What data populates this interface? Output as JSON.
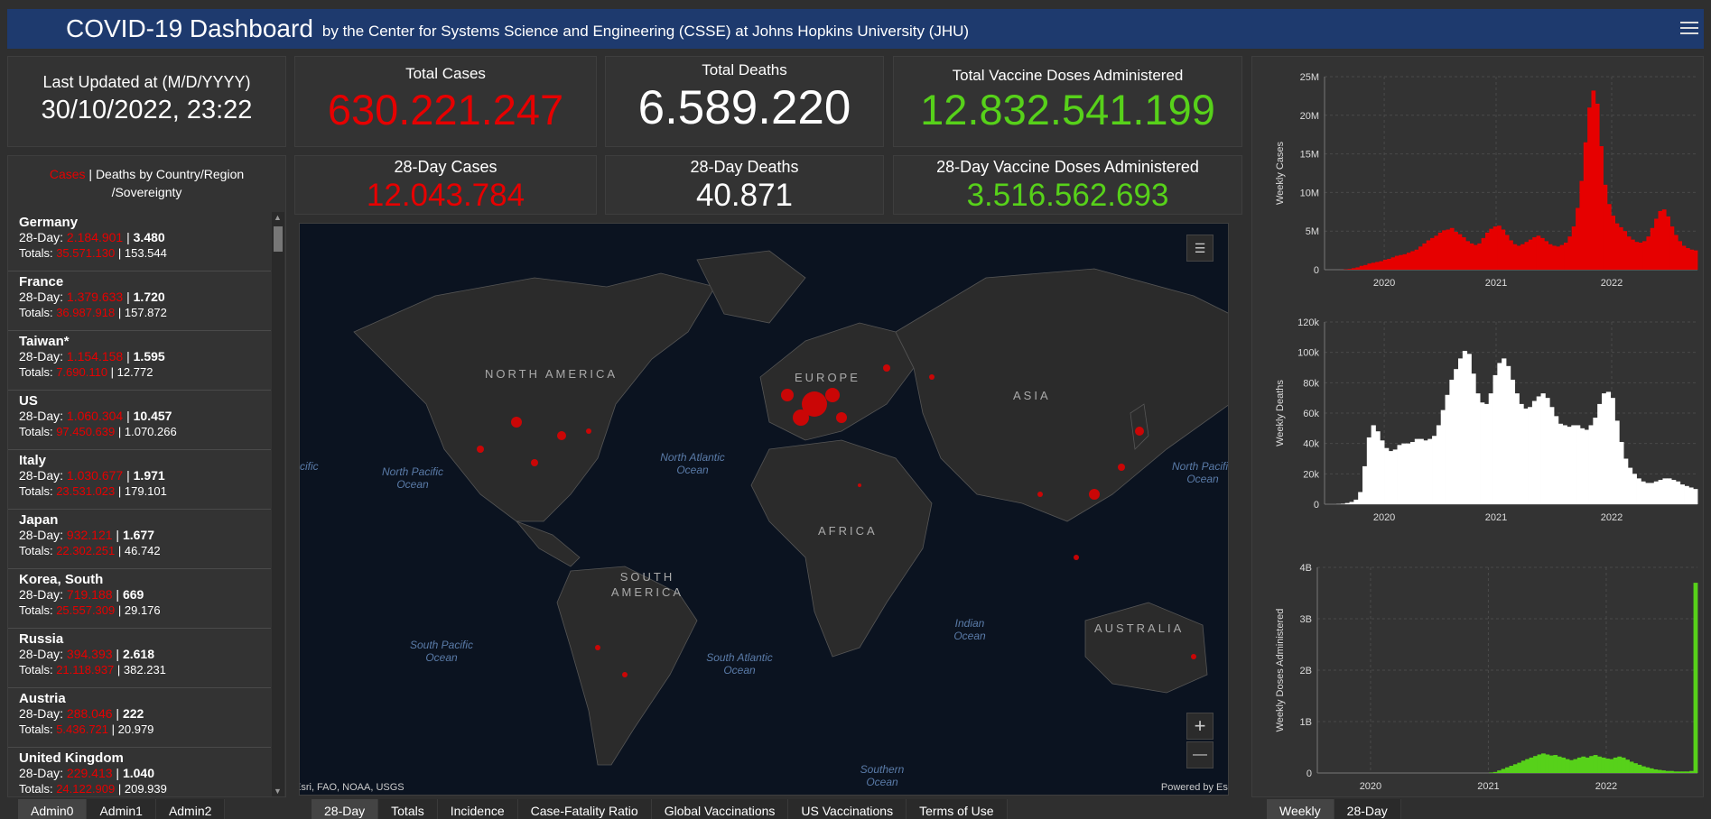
{
  "header": {
    "title": "COVID-19 Dashboard",
    "subtitle": "by the Center for Systems Science and Engineering (CSSE) at Johns Hopkins University (JHU)"
  },
  "last_updated": {
    "label": "Last Updated at (M/D/YYYY)",
    "value": "30/10/2022, 23:22"
  },
  "totals": {
    "cases_label": "Total Cases",
    "cases": "630.221.247",
    "deaths_label": "Total Deaths",
    "deaths": "6.589.220",
    "vaccine_label": "Total Vaccine Doses Administered",
    "vaccine": "12.832.541.199",
    "cases28_label": "28-Day Cases",
    "cases28": "12.043.784",
    "deaths28_label": "28-Day Deaths",
    "deaths28": "40.871",
    "vaccine28_label": "28-Day Vaccine Doses Administered",
    "vaccine28": "3.516.562.693"
  },
  "colors": {
    "cases": "#e60000",
    "deaths": "#ffffff",
    "vaccine": "#57d11a",
    "header": "#1e3a6e"
  },
  "list": {
    "title_cases": "Cases",
    "title_rest_1": " | Deaths by Country/Region",
    "title_rest_2": "/Sovereignty",
    "prefix_28": "28-Day: ",
    "prefix_tot": "Totals: ",
    "items": [
      {
        "name": "Germany",
        "c28": "2.184.901",
        "d28": "3.480",
        "ct": "35.571.130",
        "dt": "153.544"
      },
      {
        "name": "France",
        "c28": "1.379.633",
        "d28": "1.720",
        "ct": "36.987.918",
        "dt": "157.872"
      },
      {
        "name": "Taiwan*",
        "c28": "1.154.158",
        "d28": "1.595",
        "ct": "7.690.110",
        "dt": "12.772"
      },
      {
        "name": "US",
        "c28": "1.060.304",
        "d28": "10.457",
        "ct": "97.450.639",
        "dt": "1.070.266"
      },
      {
        "name": "Italy",
        "c28": "1.030.677",
        "d28": "1.971",
        "ct": "23.531.023",
        "dt": "179.101"
      },
      {
        "name": "Japan",
        "c28": "932.121",
        "d28": "1.677",
        "ct": "22.302.251",
        "dt": "46.742"
      },
      {
        "name": "Korea, South",
        "c28": "719.188",
        "d28": "669",
        "ct": "25.557.309",
        "dt": "29.176"
      },
      {
        "name": "Russia",
        "c28": "394.393",
        "d28": "2.618",
        "ct": "21.118.937",
        "dt": "382.231"
      },
      {
        "name": "Austria",
        "c28": "288.046",
        "d28": "222",
        "ct": "5.436.721",
        "dt": "20.979"
      },
      {
        "name": "United Kingdom",
        "c28": "229.413",
        "d28": "1.040",
        "ct": "24.122.909",
        "dt": "209.939"
      }
    ]
  },
  "map": {
    "continents": [
      "NORTH AMERICA",
      "EUROPE",
      "ASIA",
      "AFRICA",
      "SOUTH AMERICA",
      "AUSTRALIA"
    ],
    "oceans": [
      "North Pacific Ocean",
      "North Atlantic Ocean",
      "South Pacific Ocean",
      "South Atlantic Ocean",
      "Indian Ocean",
      "Southern Ocean",
      "North Pacific Ocean",
      "cific"
    ],
    "attribution": "Esri, FAO, NOAA, USGS",
    "powered": "Powered by Esri",
    "zoom_in": "+",
    "zoom_out": "—"
  },
  "chart_data": [
    {
      "type": "bar",
      "ylabel": "Weekly Cases",
      "yticks": [
        "0",
        "5M",
        "10M",
        "15M",
        "20M",
        "25M"
      ],
      "xticks": [
        "2020",
        "2021",
        "2022"
      ],
      "ylim": [
        0,
        25000000
      ],
      "color": "#e60000",
      "values": [
        0,
        0,
        0.01,
        0.05,
        0.1,
        0.2,
        0.3,
        0.5,
        0.6,
        0.8,
        0.9,
        1.0,
        1.1,
        1.3,
        1.4,
        1.6,
        1.8,
        1.9,
        2.0,
        2.2,
        2.4,
        2.6,
        3.0,
        3.4,
        3.8,
        4.1,
        4.4,
        4.8,
        5.1,
        5.2,
        5.4,
        4.9,
        4.6,
        4.2,
        3.7,
        3.4,
        3.2,
        3.4,
        4.1,
        4.8,
        5.3,
        5.6,
        5.7,
        5.2,
        4.5,
        3.8,
        3.3,
        3.1,
        3.3,
        3.6,
        3.9,
        4.2,
        4.4,
        4.1,
        3.7,
        3.3,
        3.1,
        3.0,
        3.2,
        3.5,
        4.3,
        5.6,
        8.0,
        11.5,
        16.5,
        21.0,
        23.2,
        21.5,
        16.0,
        11.0,
        8.5,
        7.0,
        6.0,
        5.5,
        5.0,
        4.3,
        3.9,
        3.6,
        3.5,
        3.7,
        4.3,
        5.4,
        6.6,
        7.6,
        7.8,
        6.9,
        5.6,
        4.5,
        3.7,
        3.1,
        2.8,
        2.6,
        2.5
      ]
    },
    {
      "type": "bar",
      "ylabel": "Weekly Deaths",
      "yticks": [
        "0",
        "20k",
        "40k",
        "60k",
        "80k",
        "100k",
        "120k"
      ],
      "xticks": [
        "2020",
        "2021",
        "2022"
      ],
      "ylim": [
        0,
        120000
      ],
      "color": "#ffffff",
      "values": [
        0,
        0.1,
        0.3,
        0.8,
        1.5,
        3.0,
        8.0,
        25.0,
        44.0,
        52.0,
        48.0,
        42.0,
        37.0,
        35.0,
        36.0,
        39.0,
        40.0,
        40.0,
        41.0,
        43.0,
        43.0,
        42.0,
        43.0,
        45.0,
        52.0,
        62.0,
        72.0,
        82.0,
        89.0,
        96.0,
        101.0,
        99.0,
        86.0,
        73.0,
        67.0,
        66.0,
        73.0,
        85.0,
        93.0,
        96.0,
        91.0,
        82.0,
        73.0,
        66.0,
        63.0,
        64.0,
        68.0,
        71.0,
        73.0,
        70.0,
        64.0,
        58.0,
        53.0,
        52.0,
        51.0,
        52.0,
        52.0,
        50.0,
        49.0,
        52.0,
        57.0,
        66.0,
        73.0,
        74.0,
        70.0,
        55.0,
        41.0,
        30.0,
        24.0,
        20.0,
        17.0,
        15.0,
        14.0,
        14.0,
        15.0,
        16.0,
        17.0,
        17.0,
        16.0,
        15.0,
        13.0,
        12.0,
        11.0,
        10.0
      ]
    },
    {
      "type": "bar",
      "ylabel": "Weekly Doses Administered",
      "yticks": [
        "0",
        "1B",
        "2B",
        "3B",
        "4B"
      ],
      "xticks": [
        "2020",
        "2021",
        "2022"
      ],
      "ylim": [
        0,
        4000000000
      ],
      "color": "#57d11a",
      "values": [
        0,
        0,
        0,
        0,
        0,
        0,
        0,
        0,
        0,
        0,
        0,
        0,
        0,
        0,
        0,
        0,
        0,
        0,
        0,
        0,
        0,
        0,
        0,
        0,
        0,
        0,
        0,
        0,
        0,
        0,
        0,
        0,
        0,
        0,
        0,
        0,
        0,
        0,
        0,
        0,
        0,
        0.01,
        0.02,
        0.05,
        0.08,
        0.11,
        0.14,
        0.17,
        0.2,
        0.24,
        0.27,
        0.3,
        0.33,
        0.36,
        0.38,
        0.36,
        0.34,
        0.35,
        0.32,
        0.3,
        0.27,
        0.25,
        0.27,
        0.3,
        0.32,
        0.3,
        0.33,
        0.35,
        0.32,
        0.3,
        0.28,
        0.27,
        0.3,
        0.32,
        0.3,
        0.26,
        0.22,
        0.19,
        0.16,
        0.13,
        0.11,
        0.09,
        0.07,
        0.06,
        0.05,
        0.04,
        0.04,
        0.03,
        0.03,
        0.03,
        0.03,
        0.04,
        3.7
      ]
    }
  ],
  "tabs": {
    "left": [
      "Admin0",
      "Admin1",
      "Admin2"
    ],
    "middle": [
      "28-Day",
      "Totals",
      "Incidence",
      "Case-Fatality Ratio",
      "Global Vaccinations",
      "US Vaccinations",
      "Terms of Use"
    ],
    "right": [
      "Weekly",
      "28-Day"
    ]
  }
}
